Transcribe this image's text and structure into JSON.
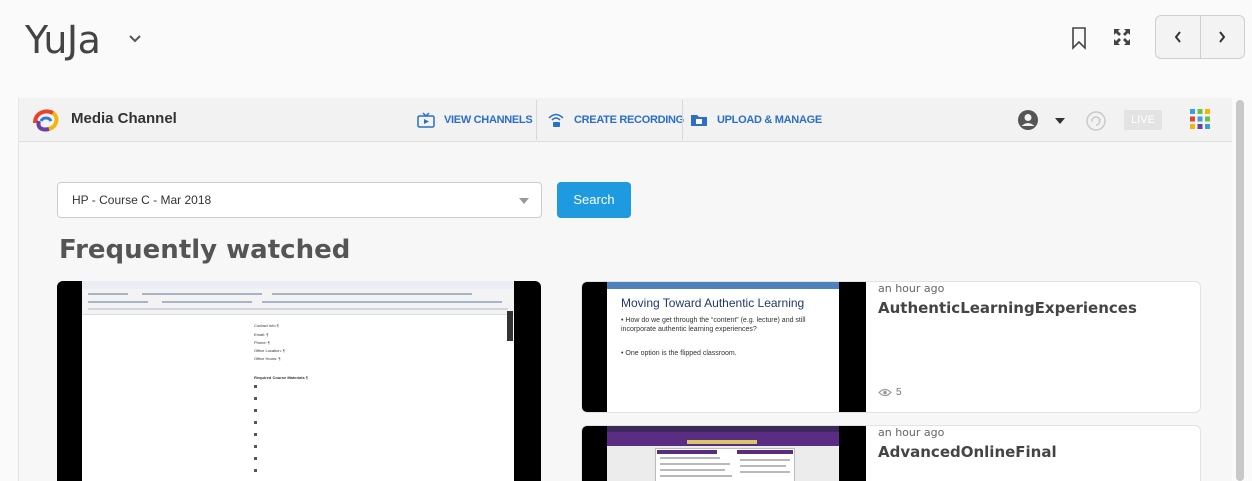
{
  "app": {
    "title": "YuJa"
  },
  "toolbar": {
    "icons": [
      "chevron-down-icon",
      "bookmark-icon",
      "expand-icon",
      "chevron-left-icon",
      "chevron-right-icon"
    ]
  },
  "media_channel": {
    "name": "Media Channel",
    "nav": {
      "view_channels": "VIEW CHANNELS",
      "create_recording": "CREATE RECORDING",
      "upload_manage": "UPLOAD & MANAGE"
    },
    "live_label": "LIVE",
    "accent_color": "#2b6fc6"
  },
  "search": {
    "selected_course": "HP - Course C - Mar 2018",
    "button_label": "Search",
    "button_color": "#1e9ae0"
  },
  "section": {
    "title": "Frequently watched"
  },
  "big_doc": {
    "lines": [
      "Contact Info ¶",
      "Email: ¶",
      "Phone: ¶",
      "Office Location: ¶",
      "Office Hours: ¶",
      "Required Course Materials ¶"
    ]
  },
  "videos": [
    {
      "time": "an hour ago",
      "title": "AuthenticLearningExperiences",
      "views": "5",
      "slide": {
        "title": "Moving Toward Authentic Learning",
        "bullet1": "• How do we get through the “content” (e.g. lecture) and still incorporate authentic learning experiences?",
        "bullet2": "• One option is the flipped classroom."
      }
    },
    {
      "time": "an hour ago",
      "title": "AdvancedOnlineFinal"
    }
  ]
}
